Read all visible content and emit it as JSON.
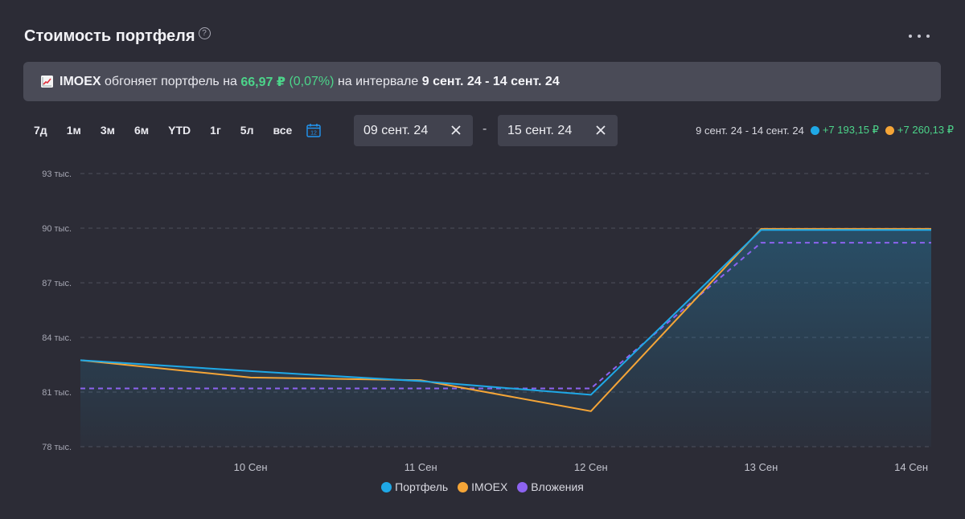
{
  "header": {
    "title": "Стоимость портфеля",
    "help_icon": "question-circle-icon",
    "more_icon": "ellipsis-icon"
  },
  "banner": {
    "icon": "chart-increasing-icon",
    "ticker": "IMOEX",
    "text1": "обгоняет портфель на",
    "amount": "66,97 ₽",
    "percent_open": "(",
    "percent": "0,07%",
    "percent_close": ")",
    "text2": "на интервале",
    "interval": "9 сент. 24 - 14 сент. 24"
  },
  "periods": [
    "7д",
    "1м",
    "3м",
    "6м",
    "YTD",
    "1г",
    "5л",
    "все"
  ],
  "calendar": {
    "icon": "calendar-icon",
    "day": "12"
  },
  "date_from": {
    "value": "09 сент. 24",
    "clear_icon": "close-icon"
  },
  "date_separator": "-",
  "date_to": {
    "value": "15 сент. 24",
    "clear_icon": "close-icon"
  },
  "summary": {
    "interval": "9 сент. 24 - 14 сент. 24",
    "portfolio_change": "+7 193,15 ₽",
    "imoex_change": "+7 260,13 ₽"
  },
  "colors": {
    "portfolio": "#1fa8e6",
    "imoex": "#f5a537",
    "investments": "#8d63f0",
    "positive": "#4cd48a"
  },
  "chart_data": {
    "type": "line",
    "x": [
      "2024-09-09",
      "2024-09-10",
      "2024-09-11",
      "2024-09-12",
      "2024-09-13",
      "2024-09-14"
    ],
    "x_tick_labels": [
      "10 Сен",
      "11 Сен",
      "12 Сен",
      "13 Сен",
      "14 Сен"
    ],
    "y_tick_labels": [
      "78 тыс.",
      "81 тыс.",
      "84 тыс.",
      "87 тыс.",
      "90 тыс.",
      "93 тыс."
    ],
    "y_ticks": [
      78000,
      81000,
      84000,
      87000,
      90000,
      93000
    ],
    "ylim": [
      78000,
      93000
    ],
    "grid": true,
    "legend_position": "bottom",
    "series": [
      {
        "name": "Портфель",
        "style": "solid",
        "filled": true,
        "values": [
          82750,
          82150,
          81600,
          80850,
          89900,
          89900
        ]
      },
      {
        "name": "IMOEX",
        "style": "solid",
        "filled": false,
        "values": [
          82750,
          81800,
          81650,
          79950,
          89960,
          89960
        ]
      },
      {
        "name": "Вложения",
        "style": "dashed",
        "filled": false,
        "values": [
          81200,
          81200,
          81200,
          81200,
          89200,
          89200
        ]
      }
    ]
  }
}
